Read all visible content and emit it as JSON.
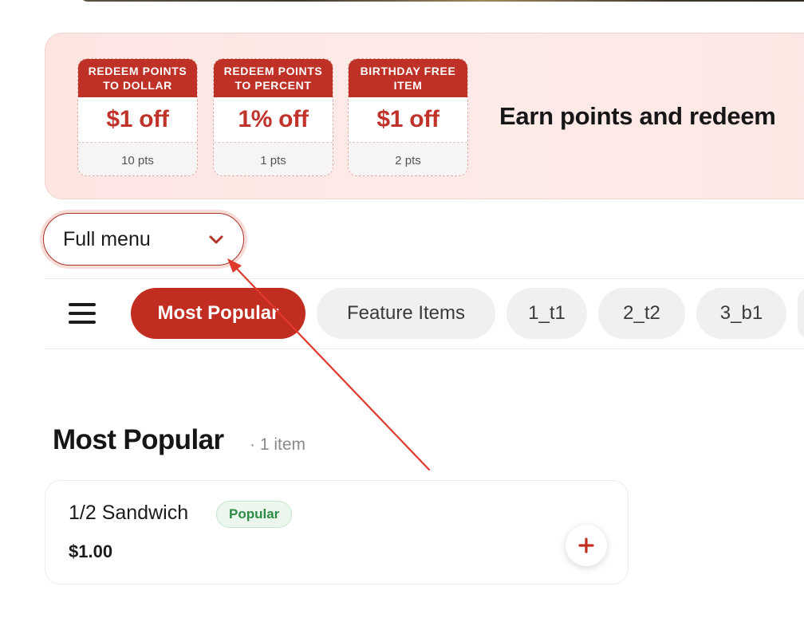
{
  "coupons": [
    {
      "title": "REDEEM POINTS TO DOLLAR",
      "value": "$1 off",
      "points": "10 pts"
    },
    {
      "title": "REDEEM POINTS TO PERCENT",
      "value": "1% off",
      "points": "1 pts"
    },
    {
      "title": "BIRTHDAY FREE ITEM",
      "value": "$1 off",
      "points": "2 pts"
    }
  ],
  "banner": {
    "headline": "Earn points and redeem"
  },
  "menu_select": {
    "value": "Full menu"
  },
  "category_tabs": [
    {
      "label": "Most Popular",
      "active": true
    },
    {
      "label": "Feature Items",
      "active": false
    },
    {
      "label": "1_t1",
      "active": false
    },
    {
      "label": "2_t2",
      "active": false
    },
    {
      "label": "3_b1",
      "active": false
    }
  ],
  "section": {
    "title": "Most Popular",
    "count": "· 1 item"
  },
  "items": [
    {
      "name": "1/2 Sandwich",
      "badge": "Popular",
      "price": "$1.00"
    }
  ],
  "colors": {
    "accent": "#c22d22",
    "badge_green": "#2d8a47",
    "annotation": "#e03a2e"
  }
}
